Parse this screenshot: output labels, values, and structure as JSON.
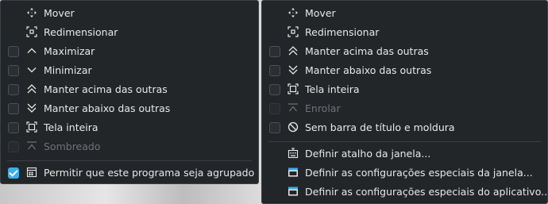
{
  "left_menu": {
    "items": [
      {
        "label": "Mover",
        "icon": "move-icon",
        "checkbox": false
      },
      {
        "label": "Redimensionar",
        "icon": "resize-icon",
        "checkbox": false
      },
      {
        "label": "Maximizar",
        "icon": "chevron-up-icon",
        "checkbox": true,
        "checked": false
      },
      {
        "label": "Minimizar",
        "icon": "chevron-down-icon",
        "checkbox": true,
        "checked": false
      },
      {
        "label": "Manter acima das outras",
        "icon": "double-chevron-up-icon",
        "checkbox": true,
        "checked": false
      },
      {
        "label": "Manter abaixo das outras",
        "icon": "double-chevron-down-icon",
        "checkbox": true,
        "checked": false
      },
      {
        "label": "Tela inteira",
        "icon": "fullscreen-icon",
        "checkbox": true,
        "checked": false
      },
      {
        "label": "Sombreado",
        "icon": "shade-icon",
        "checkbox": true,
        "checked": false,
        "disabled": true
      },
      {
        "label": "Permitir que este programa seja agrupado",
        "icon": "group-icon",
        "checkbox": true,
        "checked": true
      }
    ]
  },
  "right_menu": {
    "items": [
      {
        "label": "Mover",
        "icon": "move-icon",
        "checkbox": false
      },
      {
        "label": "Redimensionar",
        "icon": "resize-icon",
        "checkbox": false
      },
      {
        "label": "Manter acima das outras",
        "icon": "double-chevron-up-icon",
        "checkbox": true,
        "checked": false
      },
      {
        "label": "Manter abaixo das outras",
        "icon": "double-chevron-down-icon",
        "checkbox": true,
        "checked": false
      },
      {
        "label": "Tela inteira",
        "icon": "fullscreen-icon",
        "checkbox": true,
        "checked": false
      },
      {
        "label": "Enrolar",
        "icon": "shade-icon",
        "checkbox": true,
        "checked": false,
        "disabled": true
      },
      {
        "label": "Sem barra de título e moldura",
        "icon": "no-border-icon",
        "checkbox": true,
        "checked": false
      },
      {
        "label": "Definir atalho da janela...",
        "icon": "keyboard-shortcut-icon",
        "checkbox": false
      },
      {
        "label": "Definir as configurações especiais da janela...",
        "icon": "window-settings-icon",
        "checkbox": false
      },
      {
        "label": "Definir as configurações especiais do aplicativo...",
        "icon": "app-settings-icon",
        "checkbox": false
      }
    ]
  },
  "colors": {
    "menu_bg": "#232629",
    "text": "#e7e7e7",
    "disabled_text": "#6e7277",
    "accent": "#3daee9"
  }
}
